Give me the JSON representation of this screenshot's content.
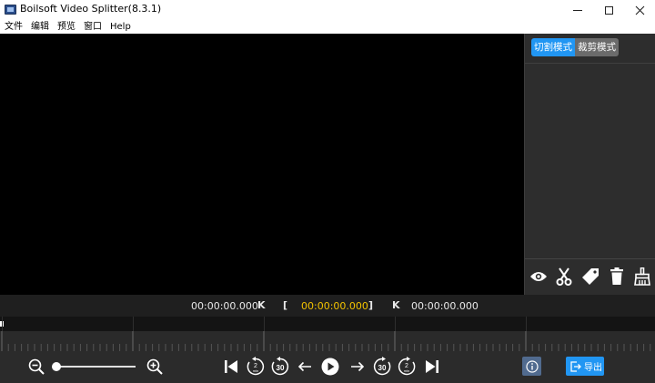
{
  "window": {
    "title": "Boilsoft Video Splitter(8.3.1)",
    "controls": [
      "minimize-icon",
      "maximize-icon",
      "close-icon"
    ]
  },
  "menu": {
    "items": [
      "文件",
      "编辑",
      "预览",
      "窗口",
      "Help"
    ]
  },
  "side_panel": {
    "tabs": [
      {
        "label": "切割模式",
        "active": true
      },
      {
        "label": "裁剪模式",
        "active": false
      }
    ],
    "tools": [
      "eye-icon",
      "scissors-icon",
      "tag-icon",
      "trash-icon",
      "broom-icon"
    ]
  },
  "timebar": {
    "current_time": "00:00:00.000",
    "mark_start_glyph": "K",
    "bracket_open": "[",
    "selection_time": "00:00:00.000",
    "bracket_close": "]",
    "mark_end_glyph": "K",
    "end_time": "00:00:00.000"
  },
  "zoom": {
    "level": 0.0
  },
  "controls": {
    "icons": [
      "zoom-out-icon",
      "zoom-in-icon",
      "skip-to-start-icon",
      "rewind-2min-icon",
      "rewind-30s-icon",
      "step-back-icon",
      "play-icon",
      "step-forward-icon",
      "forward-30s-icon",
      "forward-2min-icon",
      "skip-to-end-icon",
      "info-icon",
      "export-icon"
    ],
    "export_label": "导出"
  },
  "colors": {
    "accent": "#2196f3",
    "selection_time": "#f2c200",
    "panel": "#2d2d2d"
  }
}
